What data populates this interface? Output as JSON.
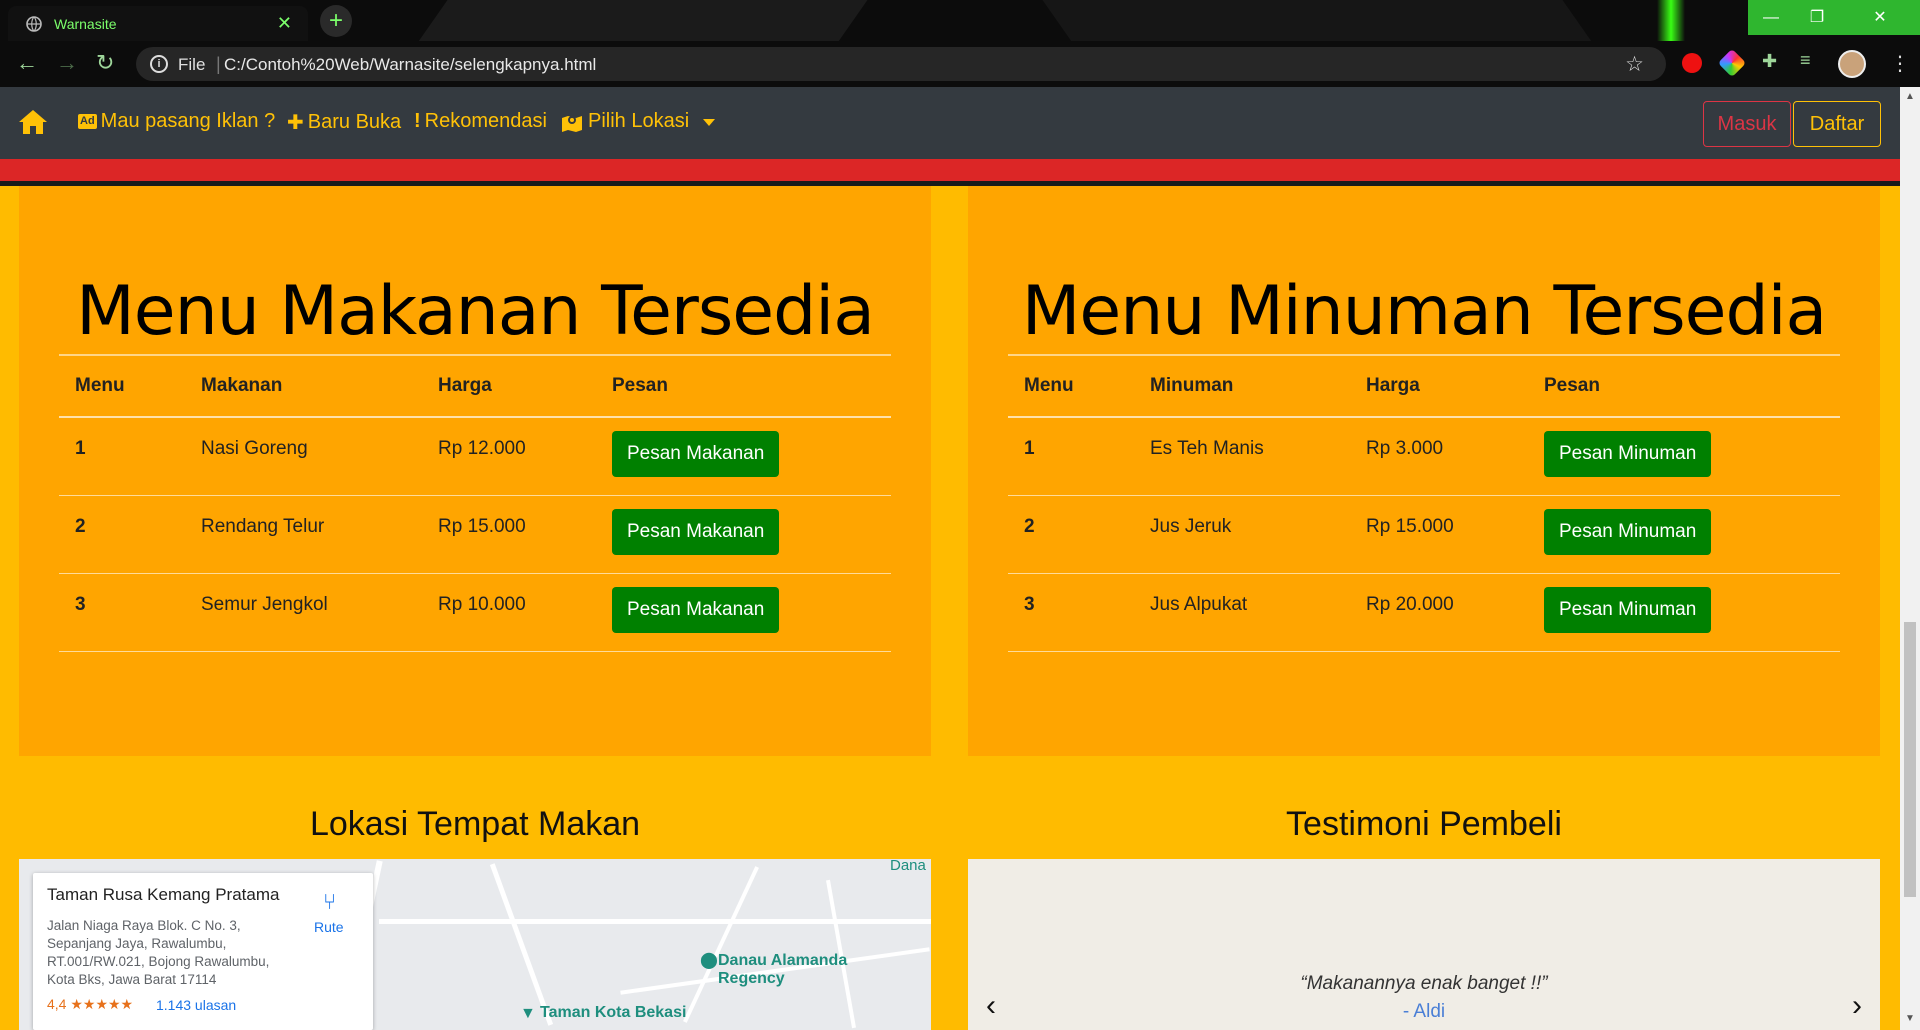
{
  "browser": {
    "tab_title": "Warnasite",
    "address_scheme": "File",
    "address_url": "C:/Contoh%20Web/Warnasite/selengkapnya.html"
  },
  "navbar": {
    "items": [
      {
        "icon": "ad-icon",
        "label": "Mau pasang Iklan ?"
      },
      {
        "icon": "plus-icon",
        "label": "Baru Buka"
      },
      {
        "icon": "exclamation-icon",
        "label": "Rekomendasi"
      },
      {
        "icon": "map-pin-icon",
        "label": "Pilih Lokasi"
      }
    ],
    "login_label": "Masuk",
    "register_label": "Daftar"
  },
  "food": {
    "title": "Menu Makanan Tersedia",
    "headers": [
      "Menu",
      "Makanan",
      "Harga",
      "Pesan"
    ],
    "rows": [
      {
        "no": "1",
        "name": "Nasi Goreng",
        "price": "Rp 12.000",
        "button": "Pesan Makanan"
      },
      {
        "no": "2",
        "name": "Rendang Telur",
        "price": "Rp 15.000",
        "button": "Pesan Makanan"
      },
      {
        "no": "3",
        "name": "Semur Jengkol",
        "price": "Rp 10.000",
        "button": "Pesan Makanan"
      }
    ]
  },
  "drink": {
    "title": "Menu Minuman Tersedia",
    "headers": [
      "Menu",
      "Minuman",
      "Harga",
      "Pesan"
    ],
    "rows": [
      {
        "no": "1",
        "name": "Es Teh Manis",
        "price": "Rp 3.000",
        "button": "Pesan Minuman"
      },
      {
        "no": "2",
        "name": "Jus Jeruk",
        "price": "Rp 15.000",
        "button": "Pesan Minuman"
      },
      {
        "no": "3",
        "name": "Jus Alpukat",
        "price": "Rp 20.000",
        "button": "Pesan Minuman"
      }
    ]
  },
  "location": {
    "title": "Lokasi Tempat Makan",
    "place_name": "Taman Rusa Kemang Pratama",
    "address": "Jalan Niaga Raya Blok. C No. 3, Sepanjang Jaya, Rawalumbu, RT.001/RW.021, Bojong Rawalumbu, Kota Bks, Jawa Barat 17114",
    "rating": "4,4 ★★★★★",
    "reviews": "1.143 ulasan",
    "route_label": "Rute",
    "map_labels": [
      "Danau Alamanda Regency",
      "Taman Kota Bekasi",
      "Dana"
    ]
  },
  "testimonial": {
    "title": "Testimoni Pembeli",
    "quote": "“Makanannya enak banget !!”",
    "author": "- Aldi",
    "prev": "‹",
    "next": "›"
  },
  "colors": {
    "page_bg": "#ffbb00",
    "card_bg": "#ffa500",
    "navbar_bg": "#343a40",
    "nav_accent": "#ffc107",
    "order_button": "#008000",
    "login_outline": "#dc3545"
  }
}
